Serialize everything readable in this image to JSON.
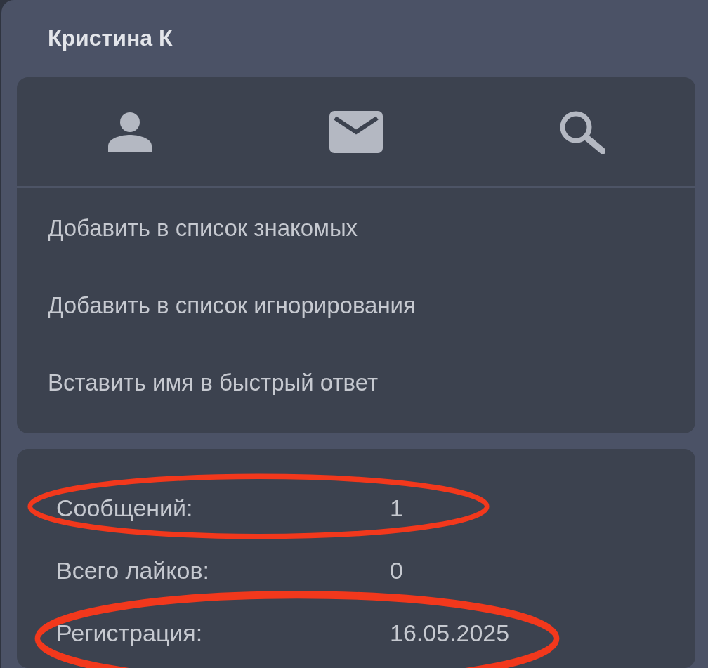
{
  "header": {
    "title": "Кристина К"
  },
  "actions": {
    "icons": [
      {
        "kind": "profile"
      },
      {
        "kind": "message"
      },
      {
        "kind": "search"
      }
    ],
    "items": [
      "Добавить в список знакомых",
      "Добавить в список игнорирования",
      "Вставить имя в быстрый ответ"
    ]
  },
  "stats": [
    {
      "label": "Сообщений:",
      "value": "1",
      "highlighted": true
    },
    {
      "label": "Всего лайков:",
      "value": "0",
      "highlighted": false
    },
    {
      "label": "Регистрация:",
      "value": "16.05.2025",
      "highlighted": true
    }
  ]
}
